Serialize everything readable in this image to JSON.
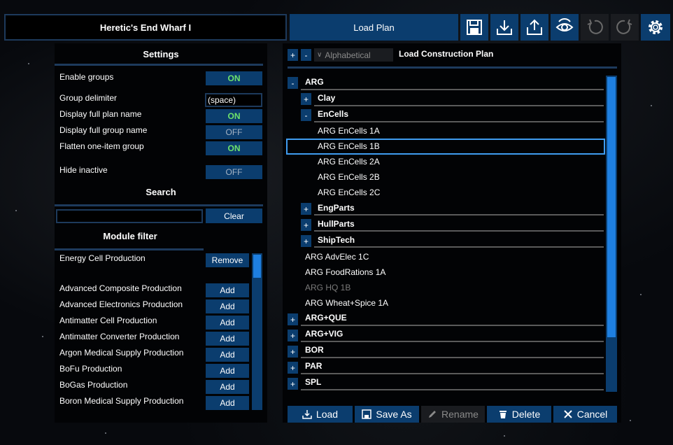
{
  "header": {
    "title": "Heretic's End Wharf I",
    "load_plan_label": "Load Plan",
    "tools": [
      {
        "icon": "save-icon"
      },
      {
        "icon": "download-icon"
      },
      {
        "icon": "share-icon"
      },
      {
        "icon": "eye-icon"
      },
      {
        "icon": "undo-icon",
        "disabled": true
      },
      {
        "icon": "redo-icon",
        "disabled": true
      },
      {
        "icon": "gear-icon"
      }
    ]
  },
  "settings": {
    "title": "Settings",
    "enable_groups": {
      "label": "Enable groups",
      "value": "ON"
    },
    "group_delimiter": {
      "label": "Group delimiter",
      "value": "(space)"
    },
    "display_full_plan_name": {
      "label": "Display full plan name",
      "value": "ON"
    },
    "display_full_group_name": {
      "label": "Display full group name",
      "value": "OFF"
    },
    "flatten_one_item_group": {
      "label": "Flatten one-item group",
      "value": "ON"
    },
    "hide_inactive": {
      "label": "Hide inactive",
      "value": "OFF"
    }
  },
  "search": {
    "title": "Search",
    "value": "",
    "clear_label": "Clear"
  },
  "module_filter": {
    "title": "Module filter",
    "active_filter": {
      "label": "Energy Cell Production",
      "remove_label": "Remove"
    },
    "add_label": "Add",
    "modules": [
      "Advanced Composite Production",
      "Advanced Electronics Production",
      "Antimatter Cell Production",
      "Antimatter Converter Production",
      "Argon Medical Supply Production",
      "BoFu Production",
      "BoGas Production",
      "Boron Medical Supply Production"
    ]
  },
  "plan_list": {
    "expand_label": "+",
    "collapse_label": "-",
    "sort": "Alphabetical",
    "title": "Load Construction Plan",
    "tree": {
      "arg": {
        "toggle": "-",
        "label": "ARG"
      },
      "clay": {
        "toggle": "+",
        "label": "Clay"
      },
      "encells": {
        "toggle": "-",
        "label": "EnCells"
      },
      "encells_items": [
        "ARG EnCells 1A",
        "ARG EnCells 1B",
        "ARG EnCells 2A",
        "ARG EnCells 2B",
        "ARG EnCells 2C"
      ],
      "engparts": {
        "toggle": "+",
        "label": "EngParts"
      },
      "hullparts": {
        "toggle": "+",
        "label": "HullParts"
      },
      "shiptech": {
        "toggle": "+",
        "label": "ShipTech"
      },
      "arg_items": [
        {
          "label": "ARG AdvElec 1C",
          "inactive": false
        },
        {
          "label": "ARG FoodRations 1A",
          "inactive": false
        },
        {
          "label": "ARG HQ 1B",
          "inactive": true
        },
        {
          "label": "ARG Wheat+Spice 1A",
          "inactive": false
        }
      ],
      "arg_que": {
        "toggle": "+",
        "label": "ARG+QUE"
      },
      "arg_vig": {
        "toggle": "+",
        "label": "ARG+VIG"
      },
      "bor": {
        "toggle": "+",
        "label": "BOR"
      },
      "par": {
        "toggle": "+",
        "label": "PAR"
      },
      "spl": {
        "toggle": "+",
        "label": "SPL"
      }
    },
    "selected": "ARG EnCells 1B"
  },
  "actions": {
    "load": "Load",
    "save_as": "Save As",
    "rename": "Rename",
    "delete": "Delete",
    "cancel": "Cancel"
  },
  "colors": {
    "button_blue": "#0b3d6e",
    "on_green": "#6ee26b",
    "selection_border": "#3f9cf0",
    "scroll_thumb": "#1e7fe0"
  }
}
